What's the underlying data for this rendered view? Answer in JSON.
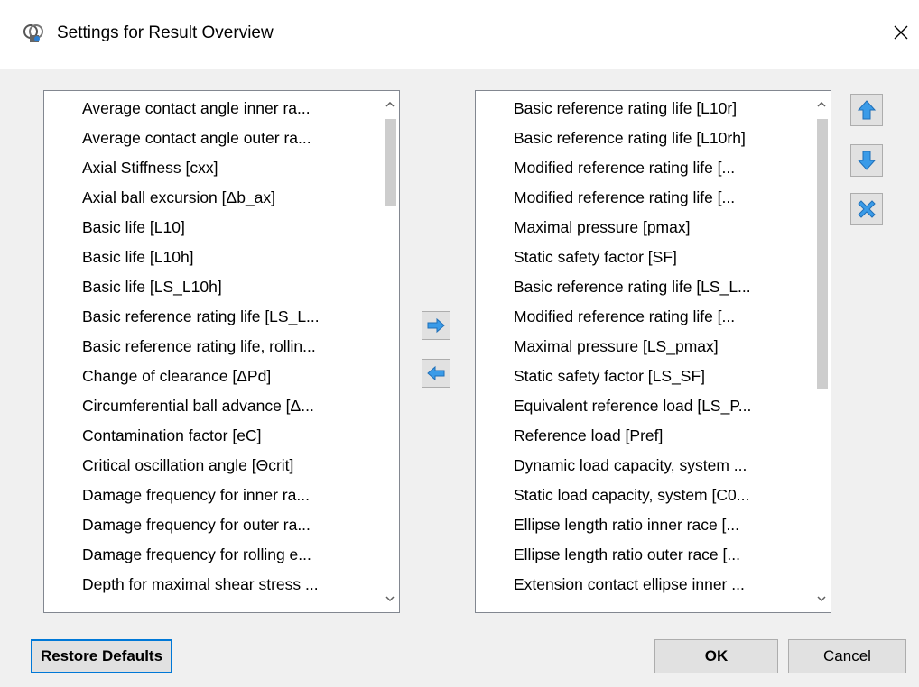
{
  "window": {
    "title": "Settings for Result Overview",
    "icon": "bearing-app-icon",
    "close_icon": "close-icon"
  },
  "available": {
    "items": [
      "Average contact angle inner ra...",
      "Average contact angle outer ra...",
      "Axial Stiffness [cxx]",
      "Axial ball excursion [Δb_ax]",
      "Basic life [L10]",
      "Basic life [L10h]",
      "Basic life [LS_L10h]",
      "Basic reference rating life [LS_L...",
      "Basic reference rating life, rollin...",
      "Change of clearance [ΔPd]",
      "Circumferential ball advance [Δ...",
      "Contamination factor [eC]",
      "Critical oscillation angle [Θcrit]",
      "Damage frequency for inner ra...",
      "Damage frequency for outer ra...",
      "Damage frequency for rolling e...",
      "Depth for maximal shear stress ..."
    ]
  },
  "selected": {
    "items": [
      "Basic reference rating life [L10r]",
      "Basic reference rating life [L10rh]",
      "Modified reference rating life [...",
      "Modified reference rating life [...",
      "Maximal pressure [pmax]",
      "Static safety factor [SF]",
      "Basic reference rating life [LS_L...",
      "Modified reference rating life [...",
      "Maximal pressure [LS_pmax]",
      "Static safety factor [LS_SF]",
      "Equivalent reference load [LS_P...",
      "Reference load [Pref]",
      "Dynamic load capacity, system ...",
      "Static load capacity, system [C0...",
      "Ellipse length ratio inner race [...",
      "Ellipse length ratio outer race [...",
      "Extension contact ellipse inner ..."
    ]
  },
  "transfer": {
    "add_icon": "arrow-right-icon",
    "remove_icon": "arrow-left-icon"
  },
  "order": {
    "up_icon": "arrow-up-icon",
    "down_icon": "arrow-down-icon",
    "delete_icon": "delete-x-icon"
  },
  "footer": {
    "restore_label": "Restore Defaults",
    "ok_label": "OK",
    "cancel_label": "Cancel"
  },
  "colors": {
    "accent": "#0078d7",
    "icon_blue": "#3a9be8"
  }
}
